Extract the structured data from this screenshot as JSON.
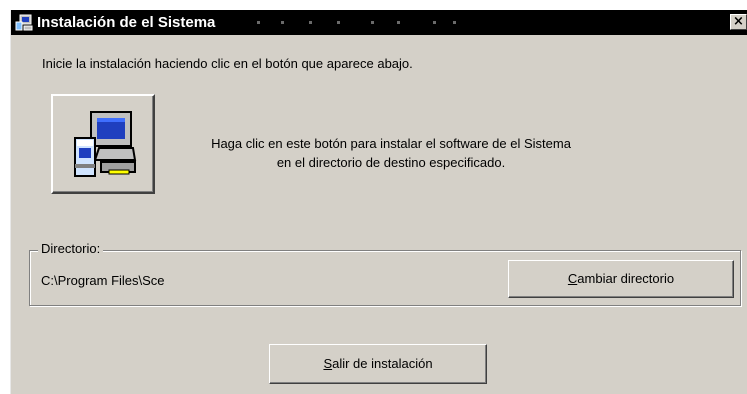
{
  "window": {
    "title": "Instalación de el Sistema",
    "close_label": "×"
  },
  "intro": {
    "text": "Inicie la instalación haciendo clic en el botón que aparece abajo."
  },
  "install": {
    "icon": "setup-computer-icon",
    "description_line1": "Haga clic en este botón para instalar el software de el Sistema",
    "description_line2": "en el directorio de destino especificado."
  },
  "directory": {
    "legend": "Directorio:",
    "path": "C:\\Program Files\\Sce",
    "change_button": {
      "mnemonic": "C",
      "rest": "ambiar directorio"
    }
  },
  "exit_button": {
    "mnemonic": "S",
    "rest": "alir de instalación"
  },
  "colors": {
    "titlebar": "#000000",
    "face": "#d4d0c8",
    "icon_screen": "#1f3fbf"
  }
}
